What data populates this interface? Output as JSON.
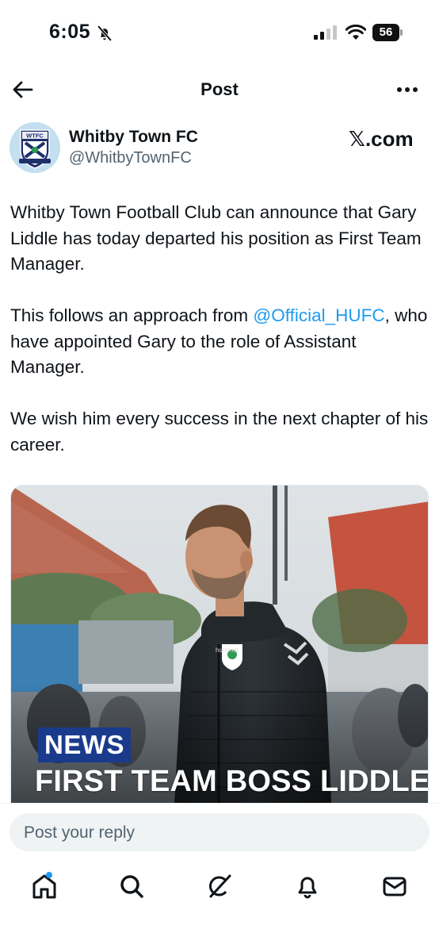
{
  "status_bar": {
    "time": "6:05",
    "battery": "56"
  },
  "header": {
    "title": "Post"
  },
  "author": {
    "name": "Whitby Town FC",
    "handle": "@WhitbyTownFC",
    "source": "𝕏.com",
    "avatar_text": "WTFC"
  },
  "tweet": {
    "p1": "Whitby Town Football Club can announce that Gary Liddle has today departed his position as First Team Manager.",
    "p2_before": "This follows an approach from ",
    "p2_mention": "@Official_HUFC",
    "p2_after": ", who have appointed Gary to the role of Assistant Manager.",
    "p3": "We wish him every success in the next chapter of his career."
  },
  "media": {
    "tag": "NEWS",
    "headline": "FIRST TEAM BOSS LIDDLE",
    "jacket_brand": "hummel",
    "jacket_badge": "WHITBY TOWN FC"
  },
  "reply": {
    "placeholder": "Post your reply"
  },
  "tabs": [
    {
      "name": "home",
      "icon": "home-icon",
      "active": true,
      "notification_dot": true
    },
    {
      "name": "search",
      "icon": "search-icon",
      "active": false
    },
    {
      "name": "grok",
      "icon": "grok-icon",
      "active": false
    },
    {
      "name": "notifications",
      "icon": "bell-icon",
      "active": false
    },
    {
      "name": "messages",
      "icon": "mail-icon",
      "active": false
    }
  ],
  "colors": {
    "accent": "#1d9bf0",
    "text": "#0f1419",
    "secondary_text": "#536471",
    "news_tag_bg": "#1a3a8c"
  }
}
